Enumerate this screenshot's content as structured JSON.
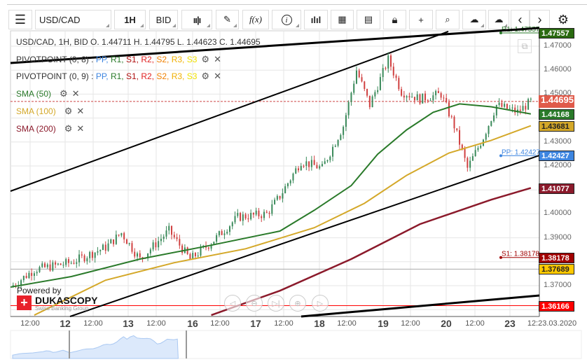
{
  "toolbar": {
    "menu_icon": "hamburger-icon",
    "instrument": "USD/CAD",
    "period": "1H",
    "side": "BID",
    "chart_type_icon": "candlestick-icon",
    "draw_icon": "pencil-icon",
    "indicator_label": "f(x)",
    "info_icon": "info-icon",
    "volume_icon": "bar-chart-icon",
    "calendar_icon": "calendar-icon",
    "news_icon": "news-icon",
    "lock_icon": "lock-icon",
    "crosshair_icon": "crosshair-icon",
    "zoom_icon": "zoom-chart-icon",
    "upload_icon": "cloud-upload-icon",
    "download_icon": "cloud-download-icon",
    "prev_icon": "chevron-left-icon",
    "next_icon": "chevron-right-icon",
    "settings_icon": "gear-icon"
  },
  "legend": {
    "ohlc": "USD/CAD, 1H, BID   O. 1.44711 H. 1.44795 L. 1.44623 C. 1.44695",
    "pivot1": "PIVOTPOINT (0, 8)",
    "pivot2": "PIVOTPOINT (0, 9)",
    "pivot_items": [
      {
        "t": "PP",
        "c": "#3d85e0"
      },
      {
        "t": "R1",
        "c": "#2a7a2a"
      },
      {
        "t": "S1",
        "c": "#b01010"
      },
      {
        "t": "R2",
        "c": "#e02020"
      },
      {
        "t": "S2",
        "c": "#f08000"
      },
      {
        "t": "R3",
        "c": "#f0b000"
      },
      {
        "t": "S3",
        "c": "#f0e000"
      }
    ],
    "sma50": "SMA (50)",
    "sma100": "SMA (100)",
    "sma200": "SMA (200)"
  },
  "colors": {
    "sma50": "#2a7a2a",
    "sma100": "#d4a829",
    "sma200": "#8b1a2b",
    "up": "#3a8a5a",
    "down": "#d04040",
    "pp": "#3d85e0",
    "s1": "#a00000"
  },
  "price_axis": [
    "1.47000",
    "1.46000",
    "1.45000",
    "1.43000",
    "1.42000",
    "1.40000",
    "1.39000",
    "1.37000"
  ],
  "tags": [
    {
      "v": "1.47557",
      "bg": "#2a6a10",
      "p": 1.47557
    },
    {
      "v": "1.44695",
      "bg": "#e05a4a",
      "p": 1.44695
    },
    {
      "v": "1.44168",
      "bg": "#2a7a2a",
      "p": 1.44168
    },
    {
      "v": "1.43681",
      "bg": "#d4a829",
      "p": 1.43681,
      "dark": true
    },
    {
      "v": "1.42427",
      "bg": "#3d85e0",
      "p": 1.42427
    },
    {
      "v": "1.41077",
      "bg": "#8b1a2b",
      "p": 1.41077
    },
    {
      "v": "1.38178",
      "bg": "#a00000",
      "p": 1.38178
    },
    {
      "v": "1.37689",
      "bg": "#ffc800",
      "p": 1.37689,
      "dark": true
    },
    {
      "v": "1.36166",
      "bg": "#ff0000",
      "p": 1.36166
    }
  ],
  "levels": {
    "r1": "R1: 1.47557",
    "pp": "PP: 1.42427",
    "s1": "S1: 1.38178"
  },
  "time_axis": [
    {
      "t": "12:00",
      "b": false
    },
    {
      "t": "12",
      "b": true
    },
    {
      "t": "12:00",
      "b": false
    },
    {
      "t": "13",
      "b": true
    },
    {
      "t": "12:00",
      "b": false
    },
    {
      "t": "16",
      "b": true
    },
    {
      "t": "12:00",
      "b": false
    },
    {
      "t": "17",
      "b": true
    },
    {
      "t": "12:00",
      "b": false
    },
    {
      "t": "18",
      "b": true
    },
    {
      "t": "12:00",
      "b": false
    },
    {
      "t": "19",
      "b": true
    },
    {
      "t": "12:00",
      "b": false
    },
    {
      "t": "20",
      "b": true
    },
    {
      "t": "12:00",
      "b": false
    },
    {
      "t": "23",
      "b": true
    }
  ],
  "time_end": "12:23.03.2020",
  "branding": {
    "powered": "Powered by",
    "brand": "DUKASCOPY",
    "tagline": "Swiss Banking Group"
  },
  "price_path": [
    [
      0,
      1.3694
    ],
    [
      9,
      1.3767
    ],
    [
      23,
      1.3797
    ],
    [
      36,
      1.386
    ],
    [
      42,
      1.392
    ],
    [
      49,
      1.381
    ],
    [
      60,
      1.393
    ],
    [
      68,
      1.381
    ],
    [
      76,
      1.388
    ],
    [
      86,
      1.3986
    ],
    [
      97,
      1.4
    ],
    [
      102,
      1.4074
    ],
    [
      110,
      1.422
    ],
    [
      118,
      1.419
    ],
    [
      126,
      1.4367
    ],
    [
      131,
      1.46
    ],
    [
      136,
      1.4454
    ],
    [
      143,
      1.4645
    ],
    [
      148,
      1.451
    ],
    [
      155,
      1.448
    ],
    [
      163,
      1.45
    ],
    [
      168,
      1.4367
    ],
    [
      173,
      1.419
    ],
    [
      179,
      1.432
    ],
    [
      184,
      1.4454
    ],
    [
      192,
      1.4425
    ],
    [
      197,
      1.4469
    ]
  ],
  "sma50": [
    [
      0,
      1.3694
    ],
    [
      23,
      1.3738
    ],
    [
      49,
      1.3811
    ],
    [
      76,
      1.3869
    ],
    [
      102,
      1.3928
    ],
    [
      115,
      1.4015
    ],
    [
      129,
      1.4118
    ],
    [
      139,
      1.4249
    ],
    [
      150,
      1.4351
    ],
    [
      160,
      1.4424
    ],
    [
      170,
      1.4459
    ],
    [
      182,
      1.4447
    ],
    [
      197,
      1.4417
    ]
  ],
  "sma100": [
    [
      9,
      1.3577
    ],
    [
      36,
      1.3723
    ],
    [
      62,
      1.3796
    ],
    [
      89,
      1.3854
    ],
    [
      115,
      1.3942
    ],
    [
      134,
      1.4044
    ],
    [
      150,
      1.4161
    ],
    [
      166,
      1.4254
    ],
    [
      182,
      1.4307
    ],
    [
      197,
      1.4368
    ]
  ],
  "sma200": [
    [
      76,
      1.3577
    ],
    [
      102,
      1.3679
    ],
    [
      129,
      1.3811
    ],
    [
      155,
      1.3957
    ],
    [
      182,
      1.4059
    ],
    [
      197,
      1.4108
    ]
  ]
}
